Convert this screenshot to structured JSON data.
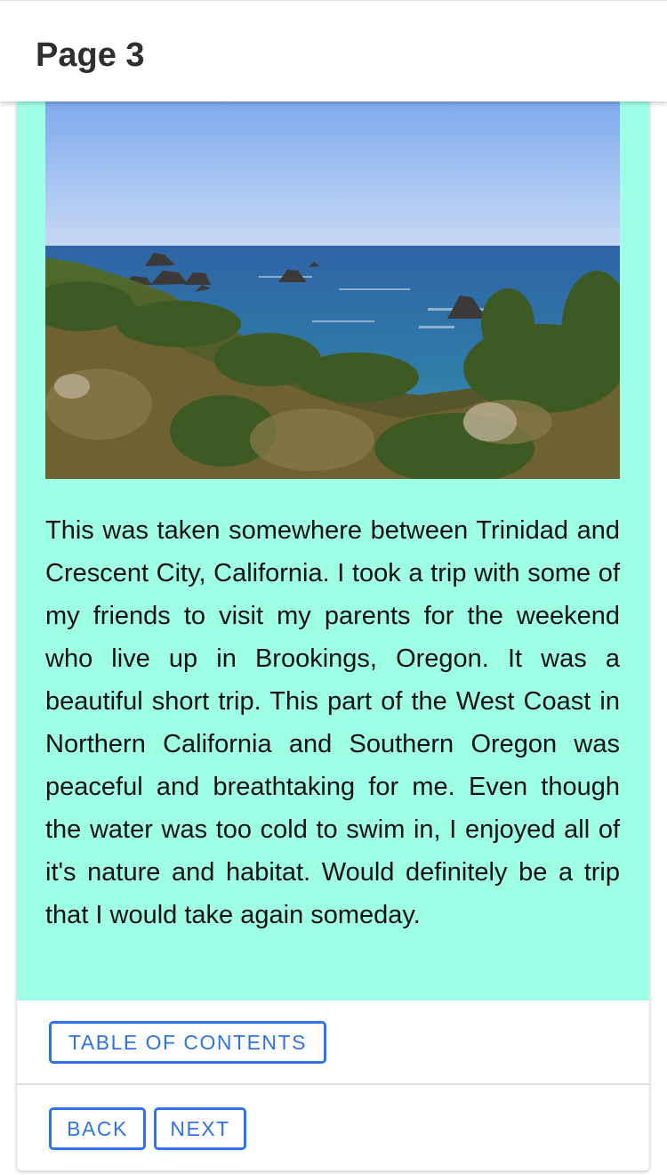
{
  "header": {
    "title": "Page 3"
  },
  "main": {
    "photo": {
      "description_icon": "coastline-photo"
    },
    "story_text": "This was taken somewhere between Trinidad and Crescent City, California. I took a trip with some of my friends to visit my parents for the weekend who live up in Brookings, Oregon. It was a beautiful short trip. This part of the West Coast in Northern California and Southern Oregon was peaceful and breathtaking for me. Even though the water was too cold to swim in, I enjoyed all of it's nature and habitat. Would definitely be a trip that I would take again someday."
  },
  "actions": {
    "toc_label": "TABLE OF CONTENTS",
    "back_label": "BACK",
    "next_label": "NEXT"
  },
  "colors": {
    "content_background": "#9effe6",
    "button_accent": "#2f73e8"
  }
}
